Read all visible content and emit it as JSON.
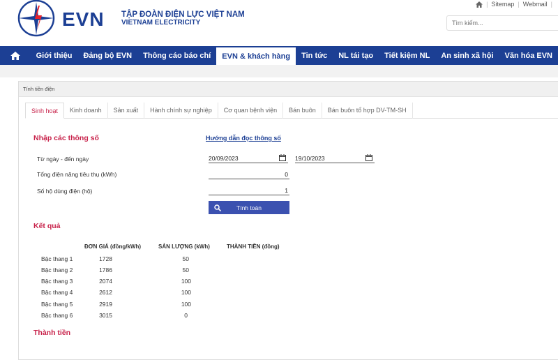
{
  "brand": {
    "logo_text": "EVN",
    "name_vi": "TẬP ĐOÀN ĐIỆN LỰC VIỆT NAM",
    "name_en": "VIETNAM ELECTRICITY",
    "primary_color": "#1c3f94",
    "accent_color": "#c8234b"
  },
  "top_links": [
    "Sitemap",
    "Webmail"
  ],
  "search": {
    "placeholder": "Tìm kiếm..."
  },
  "nav": {
    "home_icon": "home-icon",
    "items": [
      "Giới thiệu",
      "Đảng bộ EVN",
      "Thông cáo báo chí",
      "EVN & khách hàng",
      "Tin tức",
      "NL tái tạo",
      "Tiết kiệm NL",
      "An sinh xã hội",
      "Văn hóa EVN"
    ],
    "active_index": 3
  },
  "panel": {
    "title": "Tính tiền điện",
    "tabs": [
      "Sinh hoạt",
      "Kinh doanh",
      "Sản xuất",
      "Hành chính sự nghiệp",
      "Cơ quan bệnh viện",
      "Bán buôn",
      "Bán buôn tổ hợp DV-TM-SH"
    ],
    "active_tab": 0
  },
  "form": {
    "section_title": "Nhập các thông số",
    "guide_link": "Hướng dẫn đọc thông số",
    "date_range_label": "Từ ngày - đến ngày",
    "date_from": "20/09/2023",
    "date_to": "19/10/2023",
    "kwh_label": "Tổng điện năng tiêu thụ (kWh)",
    "kwh_value": "0",
    "households_label": "Số hộ dùng điện (hộ)",
    "households_value": "1",
    "calculate_button": "Tính toán"
  },
  "results": {
    "section_title": "Kết quả",
    "columns": [
      "ĐƠN GIÁ (đồng/kWh)",
      "SẢN LƯỢNG (kWh)",
      "THÀNH TIỀN (đồng)"
    ],
    "rows": [
      {
        "label": "Bậc thang 1",
        "price": "1728",
        "qty": "50"
      },
      {
        "label": "Bậc thang 2",
        "price": "1786",
        "qty": "50"
      },
      {
        "label": "Bậc thang 3",
        "price": "2074",
        "qty": "100"
      },
      {
        "label": "Bậc thang 4",
        "price": "2612",
        "qty": "100"
      },
      {
        "label": "Bậc thang 5",
        "price": "2919",
        "qty": "100"
      },
      {
        "label": "Bậc thang 6",
        "price": "3015",
        "qty": "0"
      }
    ]
  },
  "total": {
    "section_title": "Thành tiền"
  }
}
